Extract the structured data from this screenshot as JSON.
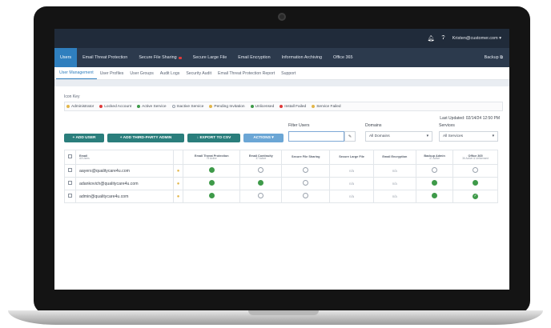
{
  "topbar": {
    "bell_icon": "bell-icon",
    "help_icon": "help-icon",
    "user_email": "Kristen@customer.com"
  },
  "main_nav": {
    "items": [
      "Users",
      "Email Threat Protection",
      "Secure File Sharing",
      "Secure Large File",
      "Email Encryption",
      "Information Archiving",
      "Office 365"
    ],
    "backup": "Backup"
  },
  "sub_nav": [
    "User Management",
    "User Profiles",
    "User Groups",
    "Audit Logs",
    "Security Audit",
    "Email Threat Protection Report",
    "Support"
  ],
  "icon_key": {
    "title": "Icon Key",
    "items": [
      {
        "label": "Administrator",
        "color": "#e2b64a"
      },
      {
        "label": "Locked Account",
        "color": "#e03a3a"
      },
      {
        "label": "Active Service",
        "color": "#3e9a49"
      },
      {
        "label": "Inactive Service",
        "color": "#ffffff"
      },
      {
        "label": "Pending Invitation",
        "color": "#e2b64a"
      },
      {
        "label": "Unlicensed",
        "color": "#3e9a49"
      },
      {
        "label": "Install Failed",
        "color": "#e03a3a"
      },
      {
        "label": "Service Failed",
        "color": "#e2b64a"
      }
    ]
  },
  "last_updated": "Last Updated: 02/14/24 12:50 PM",
  "actions": {
    "add_user": "+ ADD USER",
    "add_third_party": "+ ADD THIRD-PARTY ADMIN",
    "export": "EXPORT TO CSV",
    "actions": "ACTIONS"
  },
  "filters": {
    "filter_users_label": "Filter Users",
    "filter_users_value": "",
    "domains_label": "Domains",
    "domains_value": "All Domains",
    "services_label": "Services",
    "services_value": "All Services"
  },
  "table": {
    "user_header": "Email",
    "user_subheader": "All Users",
    "columns": [
      {
        "title": "Email Threat Protection",
        "sub": "75 Active"
      },
      {
        "title": "Email Continuity",
        "sub": "37 Active"
      },
      {
        "title": "Secure File Sharing",
        "sub": ""
      },
      {
        "title": "Secure Large File",
        "sub": ""
      },
      {
        "title": "Email Encryption",
        "sub": ""
      },
      {
        "title": "Backup Admin",
        "sub": "47 Active"
      },
      {
        "title": "Office 365",
        "sub": "36 Active & Unlicensed"
      }
    ],
    "rows": [
      {
        "email": "aayers@qualitycare4u.com",
        "services": [
          "on",
          "off",
          "off",
          "n/a",
          "n/a",
          "off",
          "off"
        ]
      },
      {
        "email": "adankovich@qualitycare4u.com",
        "services": [
          "on",
          "on",
          "off",
          "n/a",
          "n/a",
          "on",
          "on"
        ]
      },
      {
        "email": "admin@qualitycare4u.com",
        "services": [
          "on",
          "off",
          "off",
          "n/a",
          "n/a",
          "on",
          "check"
        ]
      }
    ]
  }
}
